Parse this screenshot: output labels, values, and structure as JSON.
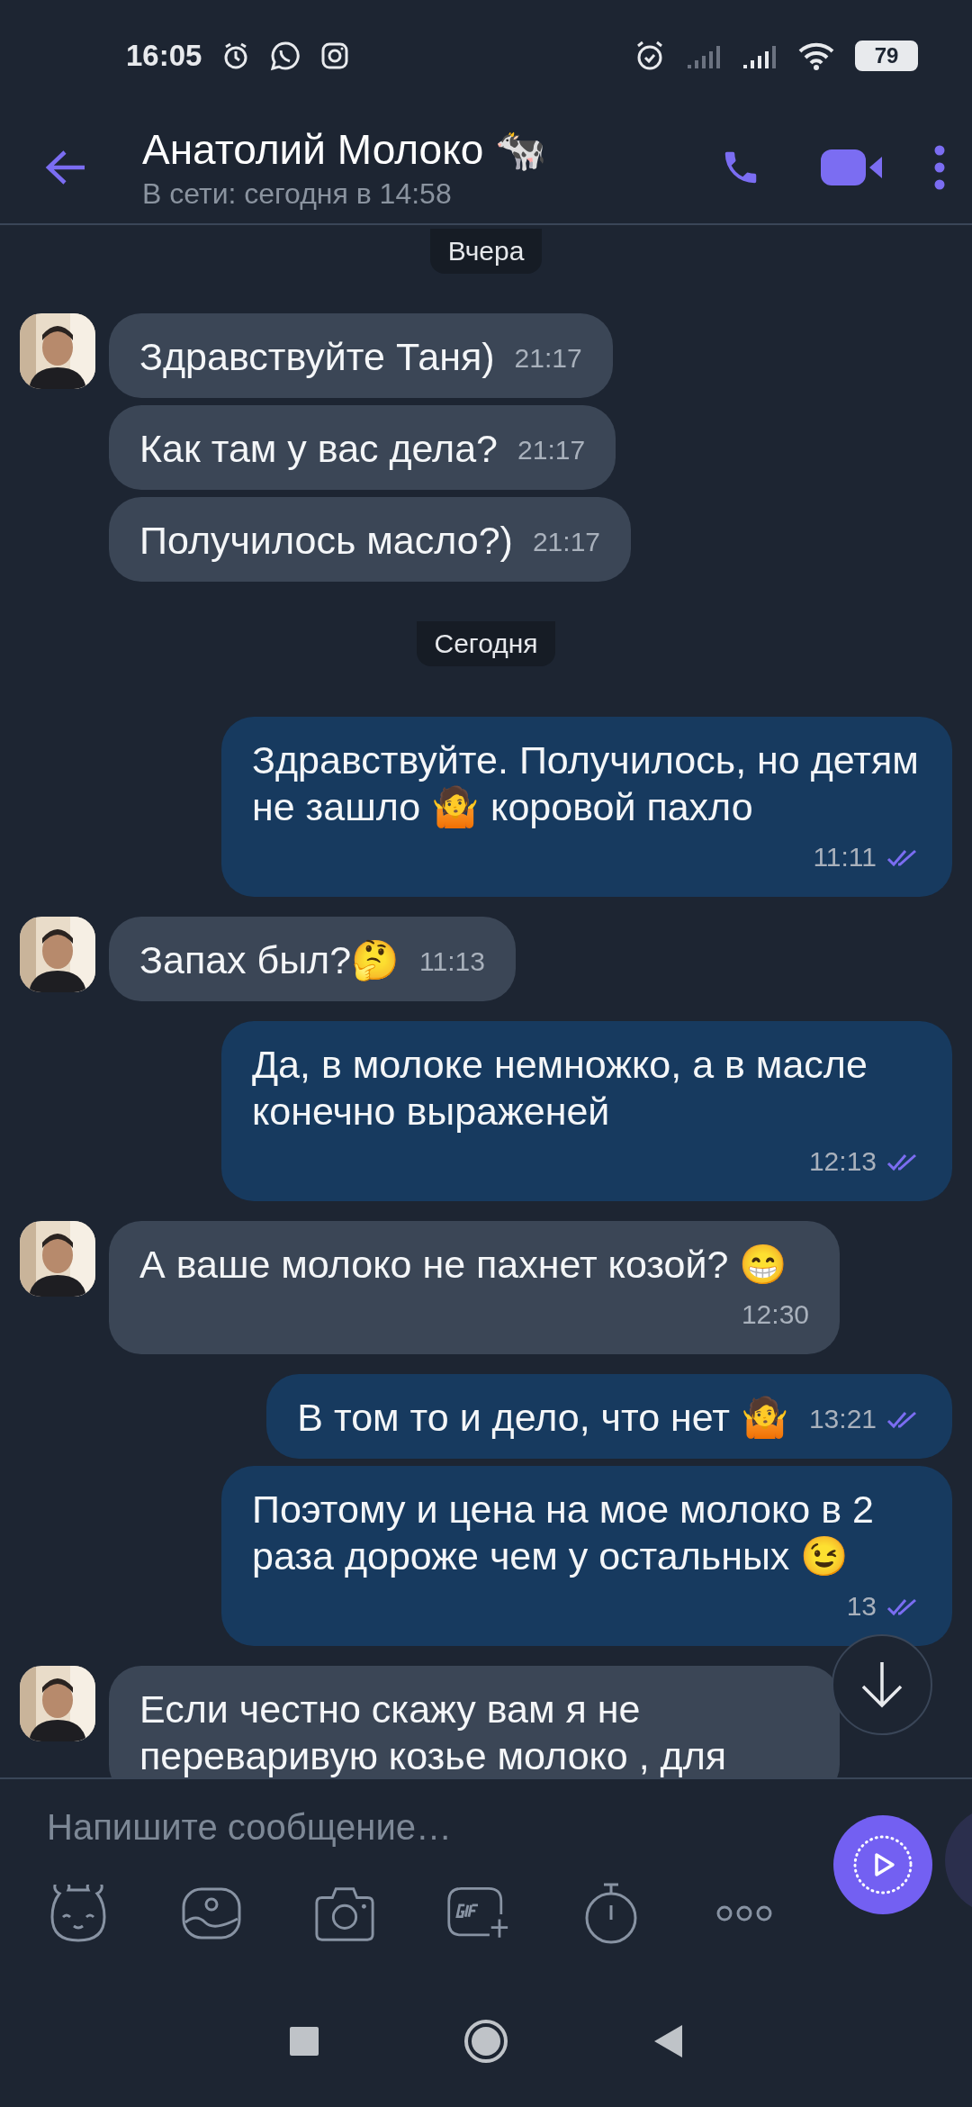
{
  "status_bar": {
    "time": "16:05",
    "battery": "79"
  },
  "header": {
    "title": "Анатолий Молоко 🐄",
    "subtitle": "В сети: сегодня в 14:58"
  },
  "messages": [
    {
      "kind": "date",
      "text": "Вчера"
    },
    {
      "kind": "incoming",
      "avatar": true,
      "text": "Здравствуйте Таня)",
      "time": "21:17"
    },
    {
      "kind": "incoming",
      "avatar": false,
      "text": "Как там у вас дела?",
      "time": "21:17"
    },
    {
      "kind": "incoming",
      "avatar": false,
      "text": "Получилось масло?)",
      "time": "21:17"
    },
    {
      "kind": "date",
      "text": "Сегодня"
    },
    {
      "kind": "outgoing",
      "read": true,
      "text": "Здравствуйте. Получилось, но детям не зашло 🤷 коровой пахло",
      "time": "11:11"
    },
    {
      "kind": "incoming",
      "avatar": true,
      "text": "Запах был?🤔",
      "time": "11:13"
    },
    {
      "kind": "outgoing",
      "read": true,
      "text": "Да, в молоке немножко, а в масле конечно выраженей",
      "time": "12:13"
    },
    {
      "kind": "incoming",
      "avatar": true,
      "text": "А ваше молоко не пахнет козой? 😁",
      "time": "12:30"
    },
    {
      "kind": "outgoing",
      "read": true,
      "text": "В том то и дело, что нет 🤷",
      "time": "13:21"
    },
    {
      "kind": "outgoing",
      "read": true,
      "text": "Поэтому и цена на мое молоко в 2 раза дороже чем у остальных 😉",
      "time": "13"
    },
    {
      "kind": "incoming",
      "avatar": true,
      "text": "Если честно скажу вам я не переваривую козье молоко , для"
    }
  ],
  "composer": {
    "placeholder": "Напишите сообщение…"
  }
}
